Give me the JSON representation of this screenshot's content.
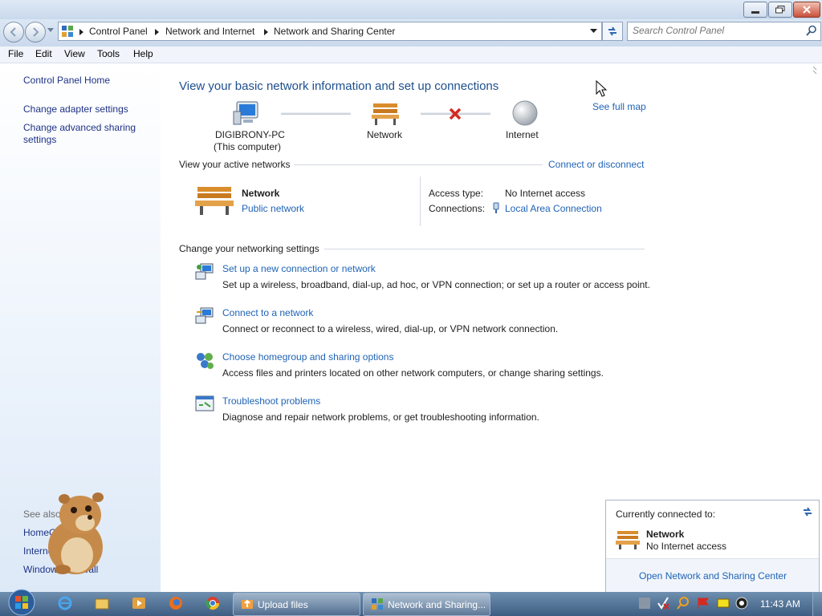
{
  "window": {
    "title_controls": [
      "minimize",
      "maximize",
      "close"
    ]
  },
  "address_bar": {
    "breadcrumbs": [
      "Control Panel",
      "Network and Internet",
      "Network and Sharing Center"
    ],
    "search_placeholder": "Search Control Panel"
  },
  "menu": [
    "File",
    "Edit",
    "View",
    "Tools",
    "Help"
  ],
  "sidebar": {
    "home": "Control Panel Home",
    "links": [
      "Change adapter settings",
      "Change advanced sharing settings"
    ],
    "see_also_label": "See also",
    "see_also": [
      "HomeGroup",
      "Internet Options",
      "Windows Firewall"
    ]
  },
  "main": {
    "title": "View your basic network information and set up connections",
    "see_full_map": "See full map",
    "map": {
      "computer_name": "DIGIBRONY-PC",
      "computer_sub": "(This computer)",
      "network": "Network",
      "internet": "Internet"
    },
    "active_networks": {
      "header": "View your active networks",
      "connect_link": "Connect or disconnect",
      "network_name": "Network",
      "network_type": "Public network",
      "access_type_label": "Access type:",
      "access_type_value": "No Internet access",
      "connections_label": "Connections:",
      "connections_value": "Local Area Connection"
    },
    "settings": {
      "header": "Change your networking settings",
      "tasks": [
        {
          "title": "Set up a new connection or network",
          "desc": "Set up a wireless, broadband, dial-up, ad hoc, or VPN connection; or set up a router or access point."
        },
        {
          "title": "Connect to a network",
          "desc": "Connect or reconnect to a wireless, wired, dial-up, or VPN network connection."
        },
        {
          "title": "Choose homegroup and sharing options",
          "desc": "Access files and printers located on other network computers, or change sharing settings."
        },
        {
          "title": "Troubleshoot problems",
          "desc": "Diagnose and repair network problems, or get troubleshooting information."
        }
      ]
    }
  },
  "popup": {
    "header": "Currently connected to:",
    "network_name": "Network",
    "network_status": "No Internet access",
    "open_link": "Open Network and Sharing Center"
  },
  "taskbar": {
    "items": [
      "Upload files",
      "Network and Sharing..."
    ],
    "clock": "11:43 AM"
  },
  "colors": {
    "link": "#1f63b6",
    "title": "#1e4f8f",
    "taskbar": "#4a6a90"
  }
}
